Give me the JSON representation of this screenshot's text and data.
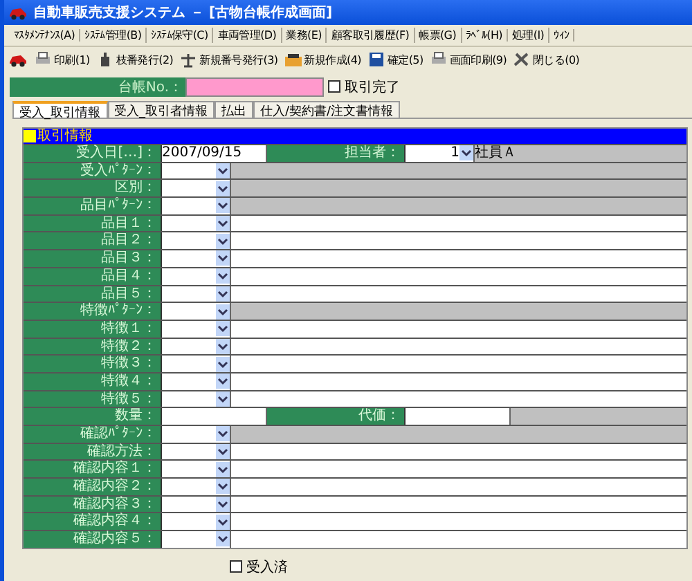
{
  "window": {
    "title": "自動車販売支援システム － [古物台帳作成画面]"
  },
  "menu": [
    "ﾏｽﾀﾒﾝﾃﾅﾝｽ(A)",
    "ｼｽﾃﾑ管理(B)",
    "ｼｽﾃﾑ保守(C)",
    "車両管理(D)",
    "業務(E)",
    "顧客取引履歴(F)",
    "帳票(G)",
    "ﾗﾍﾞﾙ(H)",
    "処理(I)",
    "ｳｨﾝ"
  ],
  "toolbar": [
    {
      "kind": "print",
      "label": "印刷(1)"
    },
    {
      "kind": "branch",
      "label": "枝番発行(2)"
    },
    {
      "kind": "number",
      "label": "新規番号発行(3)"
    },
    {
      "kind": "new",
      "label": "新規作成(4)"
    },
    {
      "kind": "save",
      "label": "確定(5)"
    },
    {
      "kind": "print",
      "label": "画面印刷(9)"
    },
    {
      "kind": "close",
      "label": "閉じる(0)"
    }
  ],
  "ledger": {
    "label": "台帳No.：",
    "done_label": "取引完了",
    "done_checked": false
  },
  "tabs": [
    {
      "label": "受入_取引情報",
      "selected": true
    },
    {
      "label": "受入_取引者情報",
      "selected": false
    },
    {
      "label": "払出",
      "selected": false
    },
    {
      "label": "仕入/契約書/注文書情報",
      "selected": false
    }
  ],
  "section": {
    "title": "取引情報"
  },
  "rows": [
    {
      "kind": "date",
      "label": "受入日[…]：",
      "value": "2007/09/15",
      "label2": "担当者：",
      "value2": "1",
      "text2": "社員Ａ"
    },
    {
      "kind": "select_gray",
      "label": "受入ﾊﾟﾀｰﾝ："
    },
    {
      "kind": "select_gray",
      "label": "区別："
    },
    {
      "kind": "select_gray",
      "label": "品目ﾊﾟﾀｰﾝ："
    },
    {
      "kind": "select_white",
      "label": "品目１："
    },
    {
      "kind": "select_white",
      "label": "品目２："
    },
    {
      "kind": "select_white",
      "label": "品目３："
    },
    {
      "kind": "select_white",
      "label": "品目４："
    },
    {
      "kind": "select_white",
      "label": "品目５："
    },
    {
      "kind": "select_gray",
      "label": "特徴ﾊﾟﾀｰﾝ："
    },
    {
      "kind": "select_white",
      "label": "特徴１："
    },
    {
      "kind": "select_white",
      "label": "特徴２："
    },
    {
      "kind": "select_white",
      "label": "特徴３："
    },
    {
      "kind": "select_white",
      "label": "特徴４："
    },
    {
      "kind": "select_white",
      "label": "特徴５："
    },
    {
      "kind": "quantity",
      "label": "数量：",
      "label2": "代価："
    },
    {
      "kind": "select_gray",
      "label": "確認ﾊﾟﾀｰﾝ："
    },
    {
      "kind": "select_white",
      "label": "確認方法："
    },
    {
      "kind": "select_white",
      "label": "確認内容１："
    },
    {
      "kind": "select_white",
      "label": "確認内容２："
    },
    {
      "kind": "select_white",
      "label": "確認内容３："
    },
    {
      "kind": "select_white",
      "label": "確認内容４："
    },
    {
      "kind": "select_white",
      "label": "確認内容５："
    }
  ],
  "received": {
    "label": "受入済",
    "checked": false
  }
}
